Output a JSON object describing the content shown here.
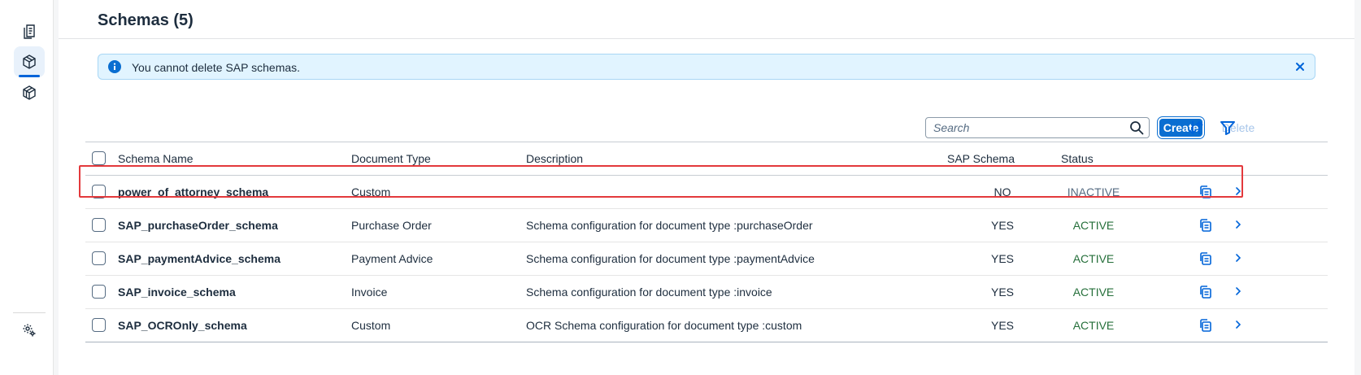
{
  "sidebar": {
    "items": [
      {
        "icon": "documents-icon"
      },
      {
        "icon": "schema-cube-icon",
        "active": true
      },
      {
        "icon": "templates-cube-icon"
      }
    ],
    "bottom_icon": "settings-gears-icon"
  },
  "header": {
    "title": "Schemas (5)"
  },
  "message_strip": {
    "text": "You cannot delete SAP schemas.",
    "type": "information"
  },
  "toolbar": {
    "search_placeholder": "Search",
    "create_label": "Create",
    "delete_label": "Delete"
  },
  "table": {
    "columns": {
      "name": "Schema Name",
      "type": "Document Type",
      "description": "Description",
      "sap_schema": "SAP Schema",
      "status": "Status"
    },
    "rows": [
      {
        "name": "power_of_attorney_schema",
        "type": "Custom",
        "description": "",
        "sap_schema": "NO",
        "status": "INACTIVE"
      },
      {
        "name": "SAP_purchaseOrder_schema",
        "type": "Purchase Order",
        "description": "Schema configuration for document type :purchaseOrder",
        "sap_schema": "YES",
        "status": "ACTIVE"
      },
      {
        "name": "SAP_paymentAdvice_schema",
        "type": "Payment Advice",
        "description": "Schema configuration for document type :paymentAdvice",
        "sap_schema": "YES",
        "status": "ACTIVE"
      },
      {
        "name": "SAP_invoice_schema",
        "type": "Invoice",
        "description": "Schema configuration for document type :invoice",
        "sap_schema": "YES",
        "status": "ACTIVE"
      },
      {
        "name": "SAP_OCROnly_schema",
        "type": "Custom",
        "description": "OCR Schema configuration for document type :custom",
        "sap_schema": "YES",
        "status": "ACTIVE"
      }
    ]
  },
  "colors": {
    "accent": "#0a6ed1",
    "active_status": "#256f3a",
    "info_strip_bg": "#e1f4ff",
    "highlight": "#e3393c"
  }
}
